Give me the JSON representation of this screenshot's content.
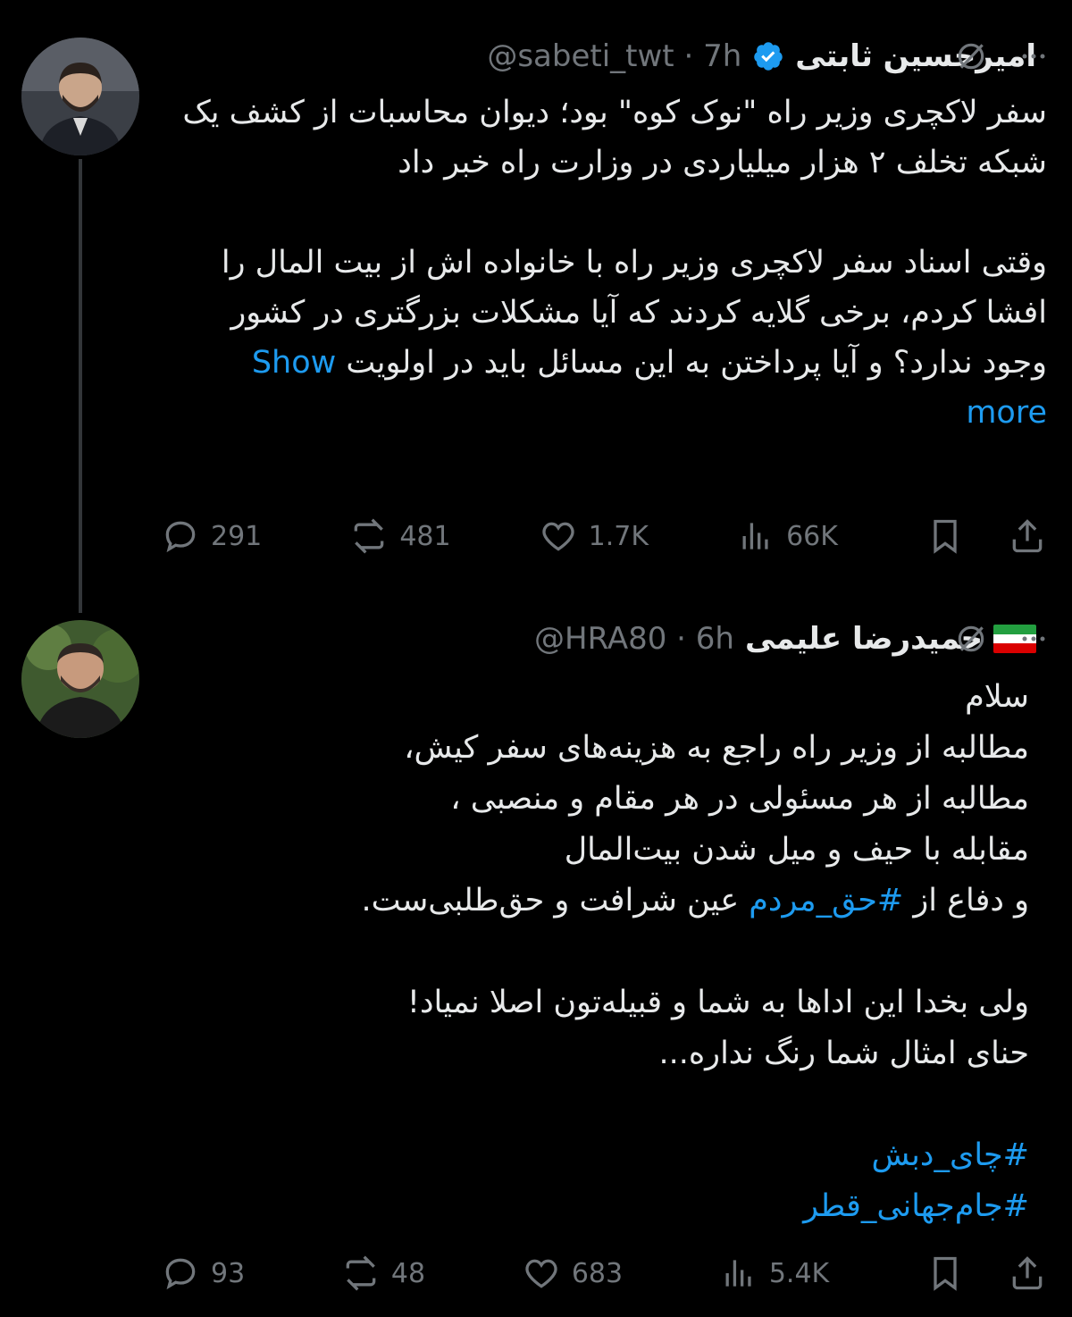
{
  "tweets": [
    {
      "author_name": "امیرحسین ثابتی",
      "handle": "@sabeti_twt",
      "time": "7h",
      "verified": true,
      "body_lines": [
        "سفر لاکچری وزیر راه \"نوک کوه\" بود؛ دیوان محاسبات از کشف یک شبکه تخلف ۲ هزار میلیاردی در وزارت راه خبر داد",
        "",
        "وقتی اسناد سفر لاکچری وزیر راه با خانواده اش از بیت المال را افشا کردم، برخی گلایه کردند که آیا مشکلات بزرگتری در کشور وجود ندارد؟ و آیا پرداختن به این مسائل باید در اولویت"
      ],
      "show_more": "Show more",
      "stats": {
        "replies": "291",
        "retweets": "481",
        "likes": "1.7K",
        "views": "66K"
      }
    },
    {
      "author_name": "حمیدرضا علیمی",
      "handle": "@HRA80",
      "time": "6h",
      "flag": "iran-flag",
      "body": {
        "line1": "سلام",
        "line2": "مطالبه از وزیر راه راجع به هزینه‌های سفر کیش،",
        "line3": "مطالبه از هر مسئولی در هر مقام و منصبی ،",
        "line4": "مقابله با حیف و میل شدن بیت‌المال",
        "line5_pre": "و دفاع از ",
        "line5_hashtag": "#حق_مردم",
        "line5_post": " عین شرافت و حق‌طلبی‌ست.",
        "line6": "ولی بخدا این اداها به شما و قبیله‌تون اصلا نمیاد!",
        "line7": "حنای امثال شما رنگ نداره...",
        "hashtag1": "#چای_دبش",
        "hashtag2": "#جام‌جهانی_قطر"
      },
      "stats": {
        "replies": "93",
        "retweets": "48",
        "likes": "683",
        "views": "5.4K"
      }
    }
  ],
  "colors": {
    "background": "#000000",
    "text": "#e7e9ea",
    "muted": "#71767b",
    "link": "#1d9bf0",
    "verified": "#1d9bf0"
  }
}
